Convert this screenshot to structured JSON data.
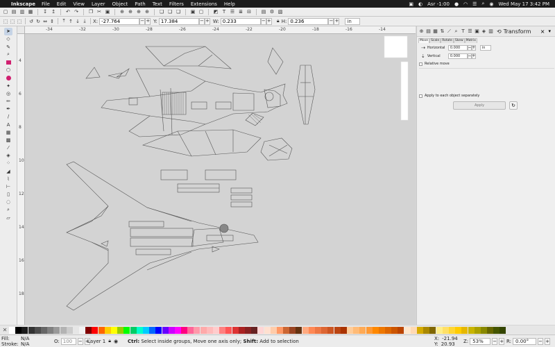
{
  "menubar": {
    "app_name": "Inkscape",
    "menus": [
      "File",
      "Edit",
      "View",
      "Layer",
      "Object",
      "Path",
      "Text",
      "Filters",
      "Extensions",
      "Help"
    ],
    "status_input": "Asr -1:00",
    "clock": "Wed May 17  3:42 PM"
  },
  "controls": {
    "x_label": "X:",
    "x_value": "-27.764",
    "y_label": "Y:",
    "y_value": "17.384",
    "w_label": "W:",
    "w_value": "0.233",
    "h_label": "H:",
    "h_value": "0.236",
    "unit": "in"
  },
  "rulers": {
    "h_labels": [
      "-34",
      "-32",
      "-30",
      "-28",
      "-26",
      "-24",
      "-22",
      "-20",
      "-18",
      "-16",
      "-14"
    ],
    "v_labels": [
      "4",
      "6",
      "8",
      "10",
      "12",
      "14",
      "16",
      "18"
    ]
  },
  "dock": {
    "title": "Transform",
    "tabs": [
      "Move",
      "Scale",
      "Rotate",
      "Skew",
      "Matrix"
    ],
    "horizontal_label": "Horizontal",
    "horizontal_value": "0.000",
    "vertical_label": "Vertical",
    "vertical_value": "0.000",
    "unit": "in",
    "relative_move_label": "Relative move",
    "apply_each_label": "Apply to each object separately",
    "apply_label": "Apply"
  },
  "palette": {
    "colors": [
      "#ffffff",
      "#000000",
      "#1a1a1a",
      "#333333",
      "#4d4d4d",
      "#666666",
      "#808080",
      "#999999",
      "#b3b3b3",
      "#cccccc",
      "#e6e6e6",
      "#f2f2f2",
      "#800000",
      "#ff0000",
      "#ff6600",
      "#ffcc00",
      "#ffff00",
      "#99cc00",
      "#00ff00",
      "#00cc66",
      "#00ffcc",
      "#00ccff",
      "#0066ff",
      "#0000ff",
      "#6600ff",
      "#cc00ff",
      "#ff00ff",
      "#ff0080",
      "#ff6699",
      "#ff99aa",
      "#ffaaaa",
      "#ffbbbb",
      "#ffcccc",
      "#ff8080",
      "#ff5555",
      "#dd3333",
      "#aa2222",
      "#882222",
      "#662222",
      "#ffd5d5",
      "#ffe0d0",
      "#ffccaa",
      "#ff9966",
      "#cc6633",
      "#994422",
      "#663311",
      "#ffaa80",
      "#ff8855",
      "#ee7744",
      "#dd6633",
      "#cc5522",
      "#bb4411",
      "#aa3300",
      "#ffcc99",
      "#ffbb77",
      "#ffaa55",
      "#ff9933",
      "#ff8800",
      "#ee7700",
      "#dd6600",
      "#cc5500",
      "#bb4400",
      "#ffe6cc",
      "#ffd9b3",
      "#d4aa00",
      "#aa8800",
      "#806600",
      "#ffee88",
      "#ffe066",
      "#ffd633",
      "#ffcc00",
      "#e6b800",
      "#c8b400",
      "#aaa000",
      "#888800",
      "#666600",
      "#445500",
      "#334400"
    ]
  },
  "status": {
    "fill_label": "Fill:",
    "fill_value": "N/A",
    "stroke_label": "Stroke:",
    "stroke_value": "N/A",
    "opacity_label": "O:",
    "opacity_value": "100",
    "layer_name": "Layer 1",
    "msg_ctrl": "Ctrl:",
    "msg_part1": " Select inside groups, Move one axis only; ",
    "msg_shift": "Shift:",
    "msg_part2": " Add to selection",
    "cursor_x_label": "X:",
    "cursor_x": "-21.94",
    "cursor_y_label": "Y:",
    "cursor_y": "20.93",
    "zoom_label": "Z:",
    "zoom_value": "53%",
    "rotation_label": "R:",
    "rotation_value": "0.00°"
  }
}
